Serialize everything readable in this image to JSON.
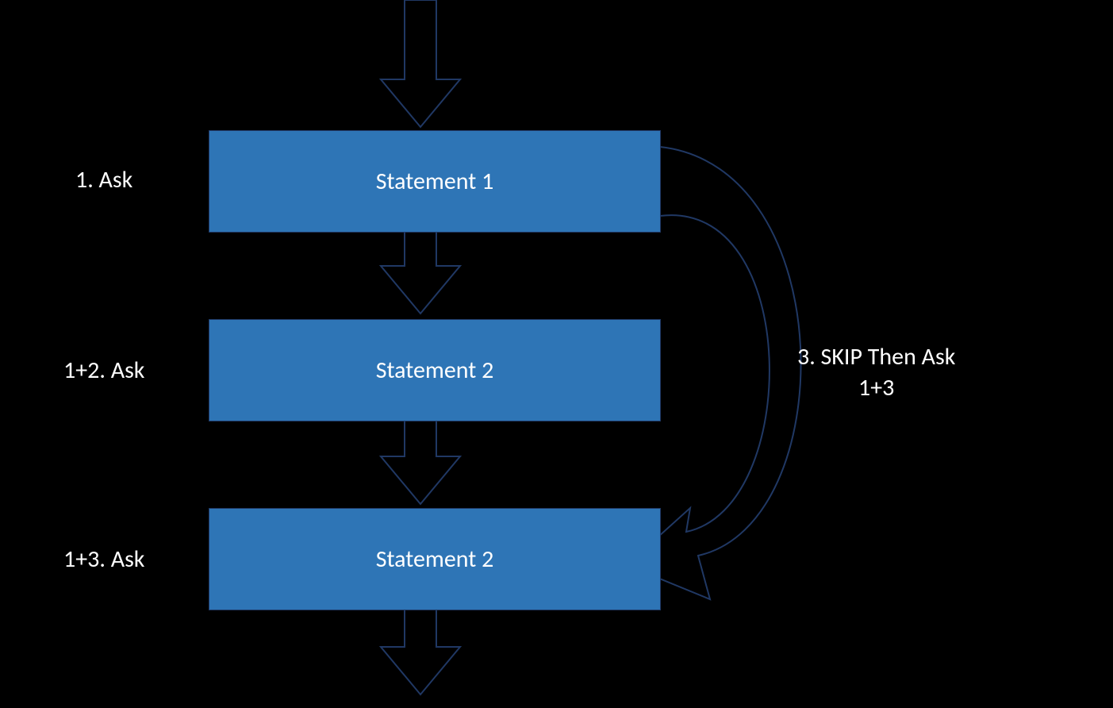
{
  "boxes": {
    "b1": {
      "label": "Statement 1"
    },
    "b2": {
      "label": "Statement 2"
    },
    "b3": {
      "label": "Statement 2"
    }
  },
  "labels": {
    "l1": "1. Ask",
    "l2": "1+2. Ask",
    "l3": "1+3. Ask",
    "r": "3. SKIP Then Ask\n1+3"
  },
  "colors": {
    "boxFill": "#2e75b6",
    "stroke": "#203864",
    "text": "#ffffff",
    "bg": "#000000"
  }
}
